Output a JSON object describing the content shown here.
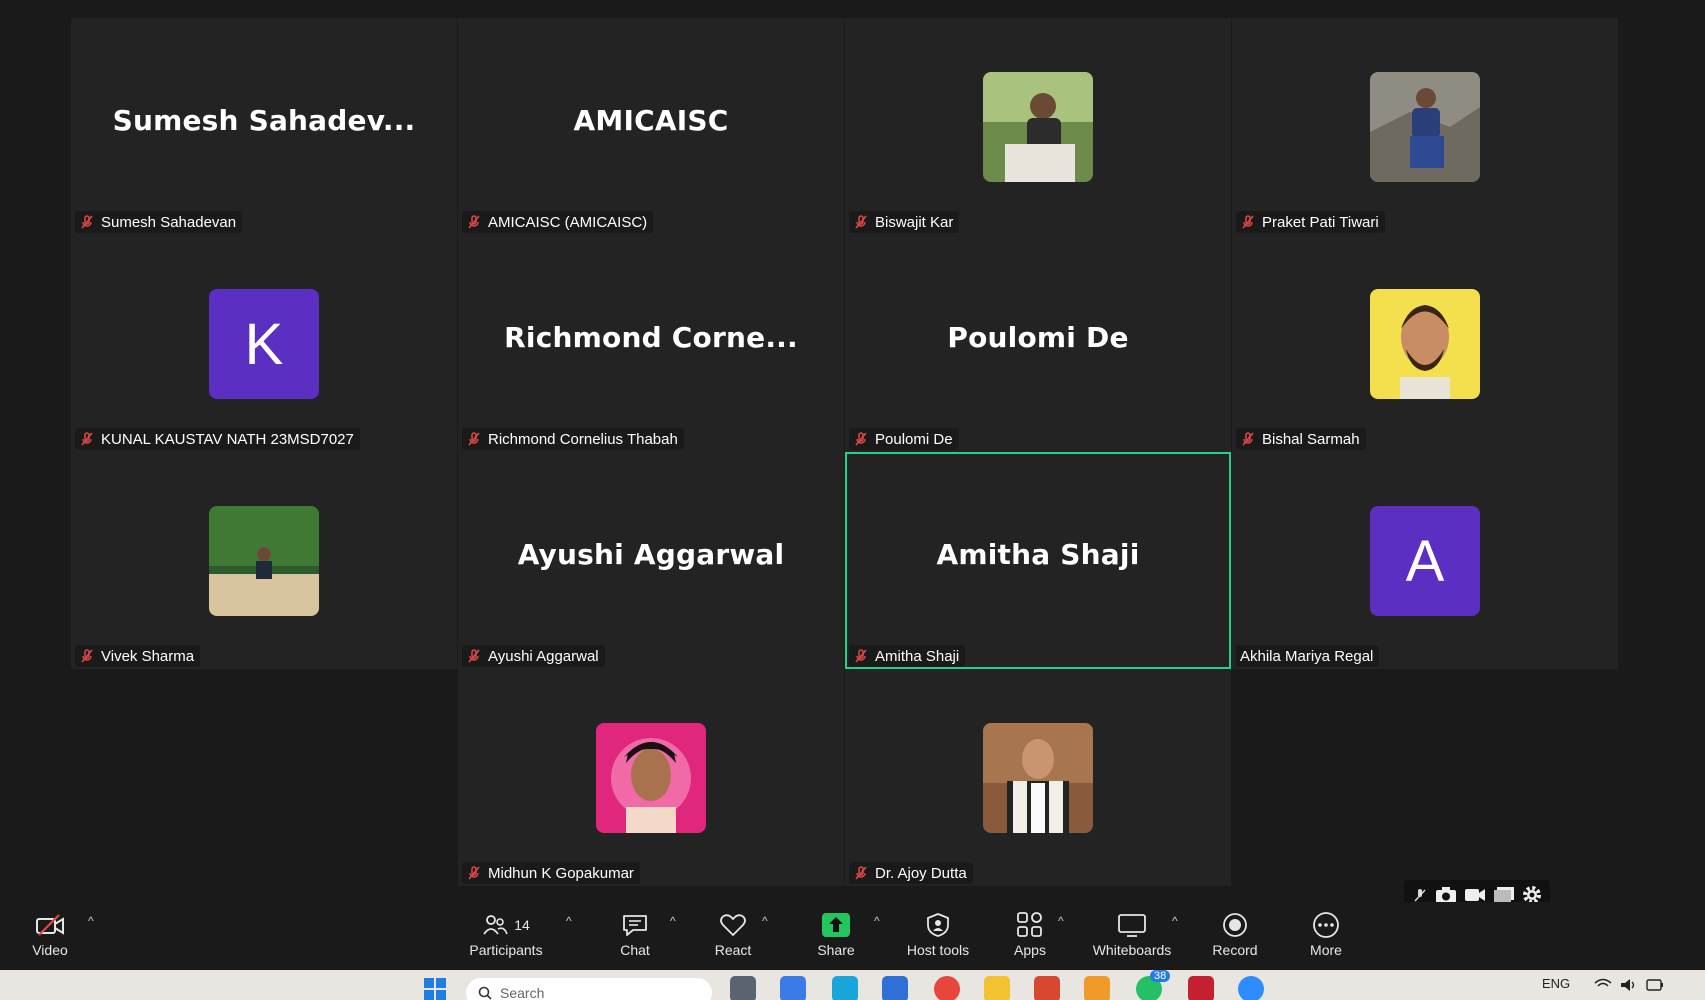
{
  "tiles": [
    {
      "label": "Sumesh Sahadevan",
      "display": "Sumesh  Sahadev...",
      "muted": true
    },
    {
      "label": "AMICAISC (AMICAISC)",
      "display": "AMICAISC",
      "muted": true
    },
    {
      "label": "Biswajit Kar",
      "display": "",
      "muted": true
    },
    {
      "label": "Praket Pati Tiwari",
      "display": "",
      "muted": true
    },
    {
      "label": "KUNAL KAUSTAV NATH 23MSD7027",
      "display": "",
      "initial": "K",
      "muted": true
    },
    {
      "label": "Richmond Cornelius Thabah",
      "display": "Richmond  Corne...",
      "muted": true
    },
    {
      "label": "Poulomi De",
      "display": "Poulomi De",
      "muted": true
    },
    {
      "label": "Bishal Sarmah",
      "display": "",
      "muted": true
    },
    {
      "label": "Vivek Sharma",
      "display": "",
      "muted": true
    },
    {
      "label": "Ayushi Aggarwal",
      "display": "Ayushi Aggarwal",
      "muted": true
    },
    {
      "label": "Amitha Shaji",
      "display": "Amitha Shaji",
      "muted": true,
      "active": true
    },
    {
      "label": "Akhila Mariya Regal",
      "display": "",
      "initial": "A",
      "muted": false
    },
    {
      "label": "Midhun K Gopakumar",
      "display": "",
      "muted": true
    },
    {
      "label": "Dr. Ajoy Dutta",
      "display": "",
      "muted": true
    }
  ],
  "toolbar": {
    "video": "Video",
    "participants": "Participants",
    "participants_count": "14",
    "chat": "Chat",
    "react": "React",
    "share": "Share",
    "host_tools": "Host tools",
    "apps": "Apps",
    "whiteboards": "Whiteboards",
    "record": "Record",
    "more": "More"
  },
  "taskbar": {
    "search_placeholder": "Search",
    "language": "ENG",
    "whatsapp_badge": "38"
  },
  "colors": {
    "active_border": "#23d18b",
    "avatar_purple": "#5b2fc2",
    "share_green": "#23c55e",
    "mute_red": "#e04848"
  }
}
